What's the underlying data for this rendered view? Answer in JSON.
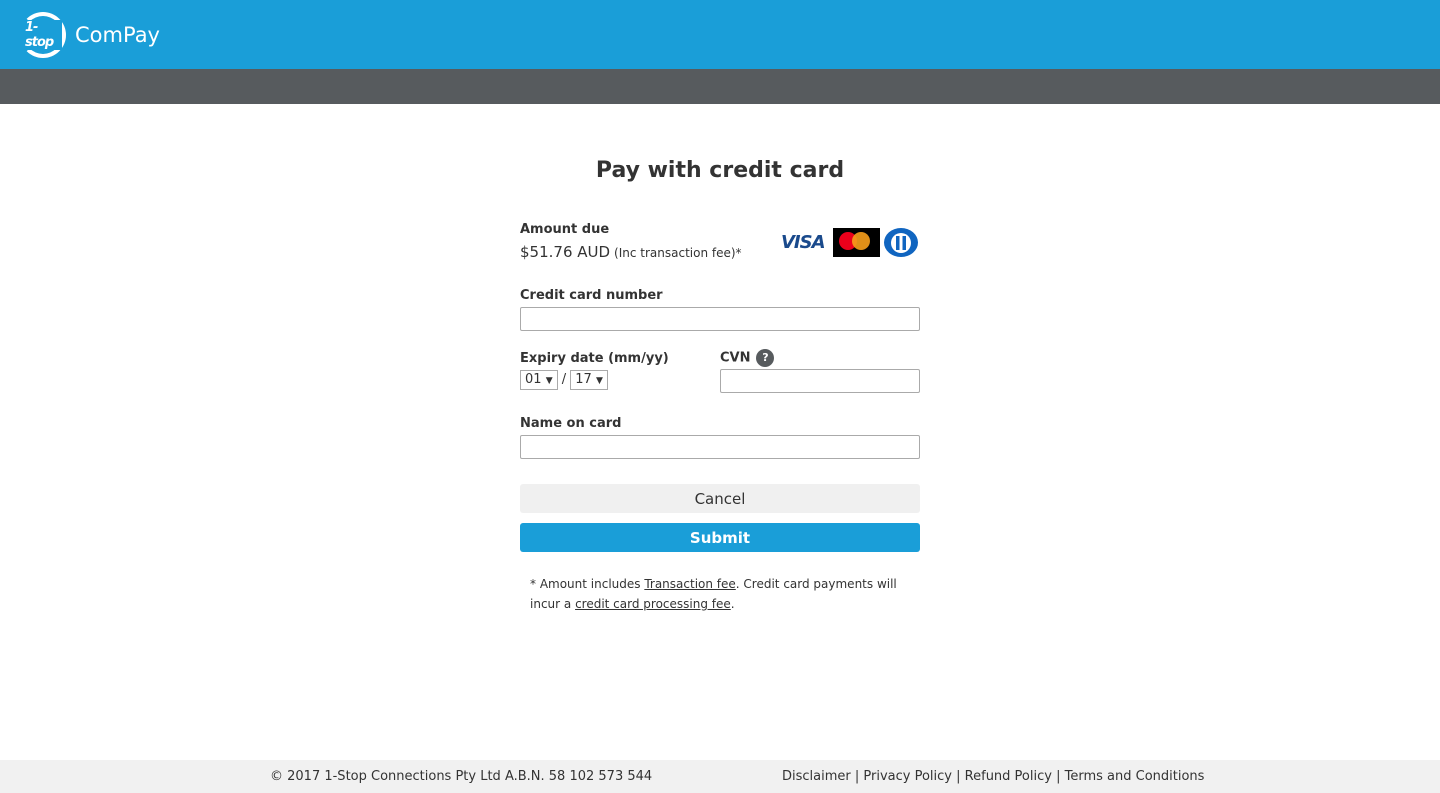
{
  "header": {
    "logo_text": "1-stop",
    "brand": "ComPay"
  },
  "page_title": "Pay with credit card",
  "amount": {
    "label": "Amount due",
    "value": "$51.76 AUD",
    "note": "(Inc transaction fee)*"
  },
  "cards": [
    "visa",
    "mastercard",
    "diners"
  ],
  "fields": {
    "card_number": {
      "label": "Credit card number",
      "value": ""
    },
    "expiry": {
      "label": "Expiry date (mm/yy)",
      "month": "01",
      "year": "17",
      "separator": "/"
    },
    "cvn": {
      "label": "CVN",
      "help": "?",
      "value": ""
    },
    "name": {
      "label": "Name on card",
      "value": ""
    }
  },
  "buttons": {
    "cancel": "Cancel",
    "submit": "Submit"
  },
  "footnote": {
    "p1": "* Amount includes ",
    "link1": "Transaction fee",
    "p2": ". Credit card payments will incur a ",
    "link2": "credit card processing fee",
    "p3": "."
  },
  "footer": {
    "copyright": "© 2017 1-Stop Connections Pty Ltd A.B.N. 58 102 573 544",
    "links": [
      "Disclaimer",
      "Privacy Policy",
      "Refund Policy",
      "Terms and Conditions"
    ],
    "sep": " | "
  },
  "colors": {
    "primary": "#1a9ed8",
    "bar": "#575b5e"
  }
}
